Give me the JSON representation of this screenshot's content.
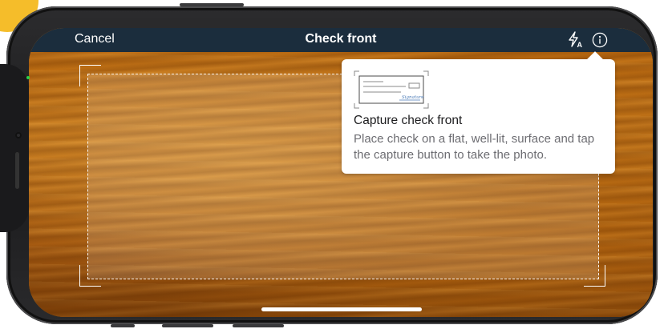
{
  "header": {
    "cancel_label": "Cancel",
    "title": "Check front",
    "flash_icon": "flash-auto-icon",
    "info_icon": "info-icon"
  },
  "popover": {
    "illustration_label": "Signature",
    "title": "Capture check front",
    "body": "Place check on a flat, well-lit, surface and tap the capture button to take the photo."
  },
  "colors": {
    "header_bg": "#1b2d3d",
    "accent_yellow": "#f5bd2a",
    "illustration_blue": "#4a7ab7"
  }
}
